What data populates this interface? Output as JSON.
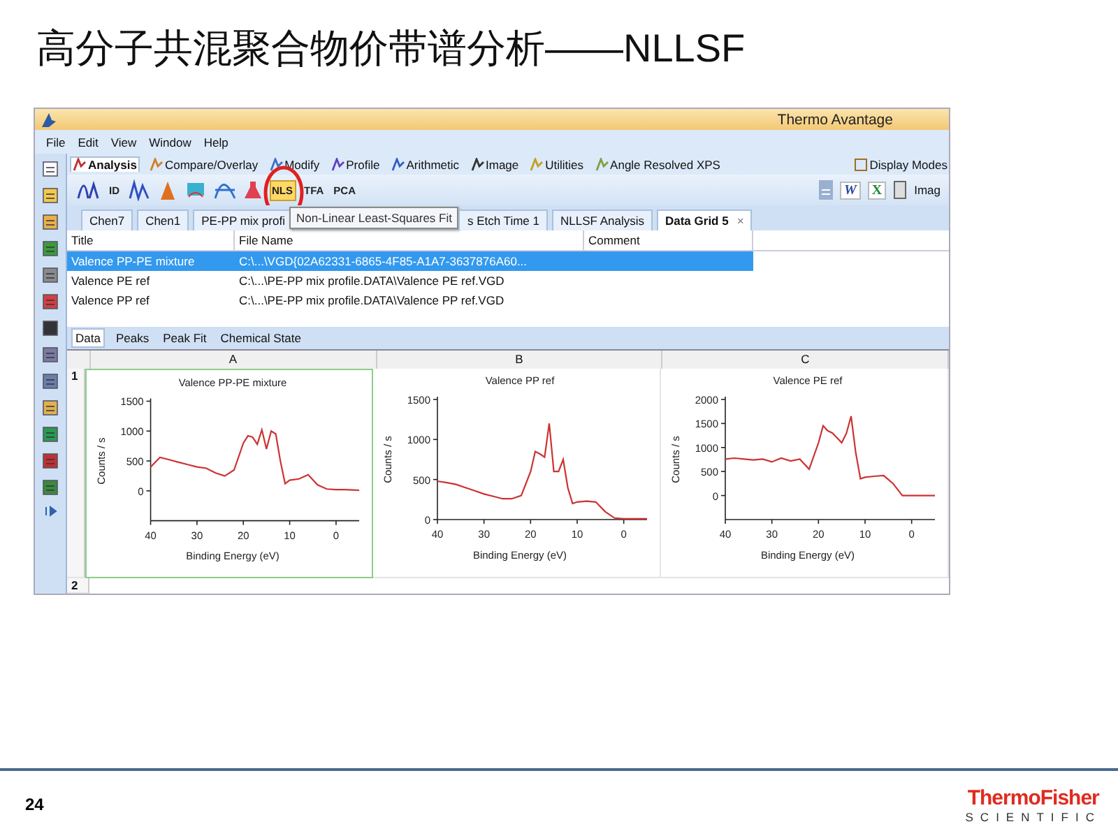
{
  "slide": {
    "title": "高分子共混聚合物价带谱分析——NLLSF",
    "page_number": "24",
    "logo": {
      "line_1": "ThermoFisher",
      "line_2": "SCIENTIFIC"
    }
  },
  "window": {
    "title": "Thermo Avantage",
    "menu": [
      "File",
      "Edit",
      "View",
      "Window",
      "Help"
    ],
    "ribbon_tabs": [
      {
        "label": "Analysis",
        "selected": true
      },
      {
        "label": "Compare/Overlay",
        "selected": false
      },
      {
        "label": "Modify",
        "selected": false
      },
      {
        "label": "Profile",
        "selected": false
      },
      {
        "label": "Arithmetic",
        "selected": false
      },
      {
        "label": "Image",
        "selected": false
      },
      {
        "label": "Utilities",
        "selected": false
      },
      {
        "label": "Angle Resolved XPS",
        "selected": false
      }
    ],
    "display_modes": "Display Modes",
    "tools": [
      {
        "label": "ID",
        "hovered": false,
        "circled": false
      },
      {
        "label": "NLS",
        "hovered": true,
        "circled": true
      },
      {
        "label": "TFA",
        "hovered": false,
        "circled": false
      },
      {
        "label": "PCA",
        "hovered": false,
        "circled": false
      }
    ],
    "export_tools": [
      "W",
      "X"
    ],
    "image_button": "Imag",
    "doc_tabs": [
      {
        "label": "Chen7",
        "selected": false
      },
      {
        "label": "Chen1",
        "selected": false
      },
      {
        "label": "PE-PP mix profi",
        "selected": false
      },
      {
        "label": "s Etch Time 1",
        "selected": false
      },
      {
        "label": "NLLSF Analysis",
        "selected": false
      },
      {
        "label": "Data Grid 5",
        "selected": true,
        "close_glyph": "×"
      }
    ],
    "tooltip": "Non-Linear Least-Squares Fit",
    "table": {
      "columns": [
        "Title",
        "File Name",
        "Comment"
      ],
      "rows": [
        {
          "cells": [
            "Valence PP-PE mixture",
            "C:\\...\\VGD{02A62331-6865-4F85-A1A7-3637876A60..."
          ],
          "selected": true
        },
        {
          "cells": [
            "Valence PE ref",
            "C:\\...\\PE-PP mix profile.DATA\\Valence PE ref.VGD"
          ],
          "selected": false
        },
        {
          "cells": [
            "Valence PP ref",
            "C:\\...\\PE-PP mix profile.DATA\\Valence PP ref.VGD"
          ],
          "selected": false
        }
      ]
    },
    "sub_tabs": [
      {
        "label": "Data",
        "selected": true
      },
      {
        "label": "Peaks",
        "selected": false
      },
      {
        "label": "Peak Fit",
        "selected": false
      },
      {
        "label": "Chemical State",
        "selected": false
      }
    ],
    "grid": {
      "columns": [
        "A",
        "B",
        "C"
      ],
      "rows": [
        {
          "label": "1",
          "cells": [
            {
              "selected": true,
              "chart_data": {
                "type": "line",
                "title": "Valence PP-PE mixture",
                "xlabel": "Binding Energy (eV)",
                "ylabel": "Counts / s",
                "xlim": [
                  40,
                  -5
                ],
                "ylim": [
                  -500,
                  1500
                ],
                "xticks": [
                  40,
                  30,
                  20,
                  10,
                  0
                ],
                "yticks": [
                  0,
                  500,
                  1000,
                  1500
                ],
                "x": [
                  40,
                  38,
                  36,
                  34,
                  32,
                  30,
                  28,
                  26,
                  24,
                  22,
                  20,
                  19,
                  18,
                  17,
                  16,
                  15,
                  14,
                  13,
                  12,
                  11,
                  10,
                  8,
                  6,
                  4,
                  2,
                  0,
                  -2,
                  -5
                ],
                "series": [
                  {
                    "color": "#cc3333",
                    "values": [
                      400,
                      560,
                      520,
                      480,
                      440,
                      400,
                      380,
                      300,
                      250,
                      350,
                      800,
                      920,
                      900,
                      780,
                      1020,
                      700,
                      1000,
                      950,
                      500,
                      120,
                      180,
                      200,
                      270,
                      100,
                      30,
                      20,
                      20,
                      10
                    ]
                  }
                ]
              }
            },
            {
              "selected": false,
              "chart_data": {
                "type": "line",
                "title": "Valence PP ref",
                "xlabel": "Binding Energy (eV)",
                "ylabel": "Counts / s",
                "xlim": [
                  40,
                  -5
                ],
                "ylim": [
                  0,
                  1500
                ],
                "xticks": [
                  40,
                  30,
                  20,
                  10,
                  0
                ],
                "yticks": [
                  0,
                  500,
                  1000,
                  1500
                ],
                "x": [
                  40,
                  38,
                  36,
                  34,
                  32,
                  30,
                  28,
                  26,
                  24,
                  22,
                  20,
                  19,
                  18,
                  17,
                  16,
                  15,
                  14,
                  13,
                  12,
                  11,
                  10,
                  8,
                  6,
                  4,
                  2,
                  0,
                  -2,
                  -5
                ],
                "series": [
                  {
                    "color": "#cc3333",
                    "values": [
                      480,
                      460,
                      440,
                      400,
                      360,
                      320,
                      290,
                      260,
                      260,
                      300,
                      600,
                      850,
                      820,
                      780,
                      1200,
                      600,
                      600,
                      750,
                      400,
                      200,
                      220,
                      230,
                      220,
                      100,
                      20,
                      10,
                      10,
                      10
                    ]
                  }
                ]
              }
            },
            {
              "selected": false,
              "chart_data": {
                "type": "line",
                "title": "Valence PE ref",
                "xlabel": "Binding Energy (eV)",
                "ylabel": "Counts / s",
                "xlim": [
                  40,
                  -5
                ],
                "ylim": [
                  -500,
                  2000
                ],
                "xticks": [
                  40,
                  30,
                  20,
                  10,
                  0
                ],
                "yticks": [
                  0,
                  500,
                  1000,
                  1500,
                  2000
                ],
                "x": [
                  40,
                  38,
                  36,
                  34,
                  32,
                  30,
                  28,
                  26,
                  24,
                  22,
                  20,
                  19,
                  18,
                  17,
                  16,
                  15,
                  14,
                  13,
                  12,
                  11,
                  10,
                  8,
                  6,
                  4,
                  2,
                  0,
                  -2,
                  -5
                ],
                "series": [
                  {
                    "color": "#cc3333",
                    "values": [
                      760,
                      780,
                      760,
                      740,
                      760,
                      700,
                      780,
                      720,
                      760,
                      550,
                      1100,
                      1450,
                      1350,
                      1300,
                      1200,
                      1100,
                      1300,
                      1650,
                      900,
                      350,
                      380,
                      400,
                      420,
                      250,
                      0,
                      0,
                      0,
                      0
                    ]
                  }
                ]
              }
            }
          ]
        },
        {
          "label": "2",
          "cells": []
        }
      ]
    }
  }
}
